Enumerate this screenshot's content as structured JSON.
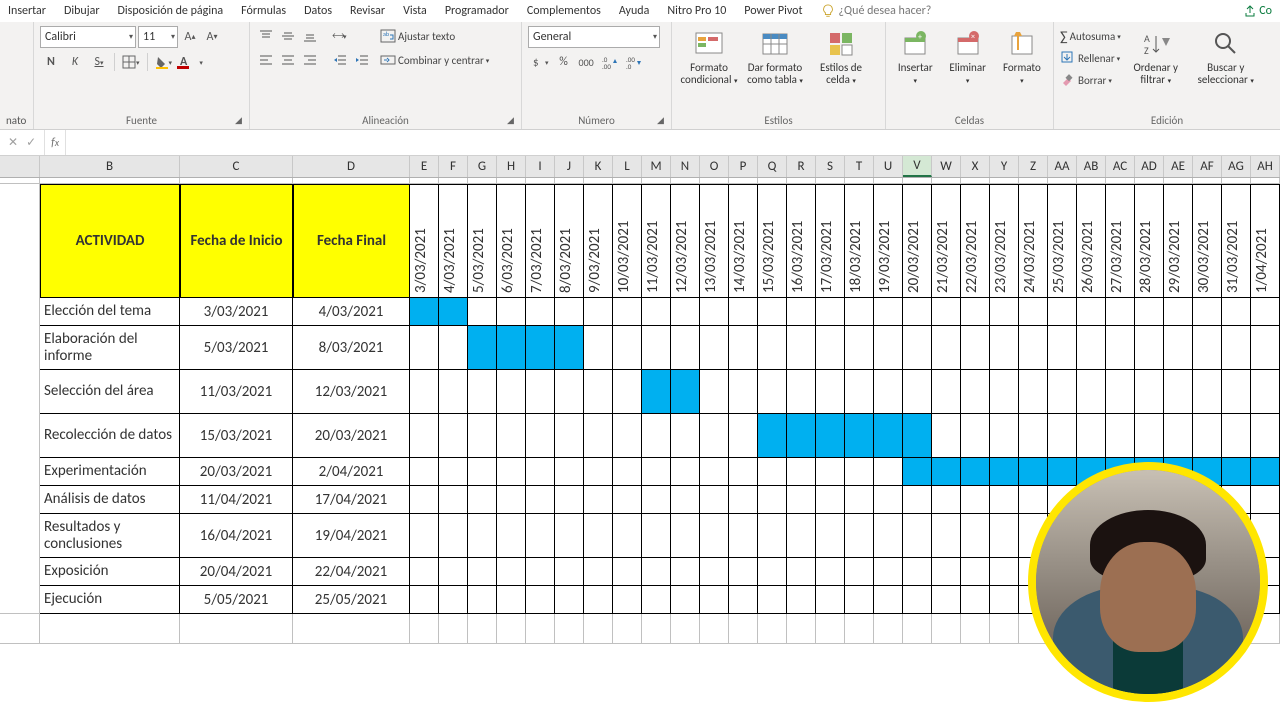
{
  "menu": {
    "tabs": [
      "Insertar",
      "Dibujar",
      "Disposición de página",
      "Fórmulas",
      "Datos",
      "Revisar",
      "Vista",
      "Programador",
      "Complementos",
      "Ayuda",
      "Nitro Pro 10",
      "Power Pivot"
    ],
    "tellme_placeholder": "¿Qué desea hacer?",
    "share": "Co"
  },
  "ribbon": {
    "clipboard_stub": "nato",
    "font": {
      "name": "Calibri",
      "size": "11",
      "bold": "N",
      "italic": "K",
      "underline": "S",
      "group_label": "Fuente"
    },
    "alignment": {
      "wrap": "Ajustar texto",
      "merge": "Combinar y centrar",
      "group_label": "Alineación"
    },
    "number": {
      "format": "General",
      "group_label": "Número"
    },
    "styles": {
      "cond": "Formato condicional",
      "table": "Dar formato como tabla",
      "cell": "Estilos de celda",
      "group_label": "Estilos"
    },
    "cells": {
      "insert": "Insertar",
      "delete": "Eliminar",
      "format": "Formato",
      "group_label": "Celdas"
    },
    "editing": {
      "sum": "Autosuma",
      "fill": "Rellenar",
      "clear": "Borrar",
      "sort": "Ordenar y filtrar",
      "find": "Buscar y seleccionar",
      "group_label": "Edición"
    }
  },
  "columns": [
    "",
    "B",
    "C",
    "D",
    "E",
    "F",
    "G",
    "H",
    "I",
    "J",
    "K",
    "L",
    "M",
    "N",
    "O",
    "P",
    "Q",
    "R",
    "S",
    "T",
    "U",
    "V",
    "W",
    "X",
    "Y",
    "Z",
    "AA",
    "AB",
    "AC",
    "AD",
    "AE",
    "AF",
    "AG",
    "AH"
  ],
  "selected_col": "V",
  "table": {
    "headers": {
      "b": "ACTIVIDAD",
      "c": "Fecha de Inicio",
      "d": "Fecha Final"
    },
    "dates": [
      "3/03/2021",
      "4/03/2021",
      "5/03/2021",
      "6/03/2021",
      "7/03/2021",
      "8/03/2021",
      "9/03/2021",
      "10/03/2021",
      "11/03/2021",
      "12/03/2021",
      "13/03/2021",
      "14/03/2021",
      "15/03/2021",
      "16/03/2021",
      "17/03/2021",
      "18/03/2021",
      "19/03/2021",
      "20/03/2021",
      "21/03/2021",
      "22/03/2021",
      "23/03/2021",
      "24/03/2021",
      "25/03/2021",
      "26/03/2021",
      "27/03/2021",
      "28/03/2021",
      "29/03/2021",
      "30/03/2021",
      "31/03/2021",
      "1/04/2021"
    ],
    "rows": [
      {
        "b": "Elección del tema",
        "c": "3/03/2021",
        "d": "4/03/2021",
        "start": 0,
        "end": 1,
        "h": "rowh1"
      },
      {
        "b": "Elaboración del informe",
        "c": "5/03/2021",
        "d": "8/03/2021",
        "start": 2,
        "end": 5,
        "h": "rowh2"
      },
      {
        "b": "Selección del área",
        "c": "11/03/2021",
        "d": "12/03/2021",
        "start": 8,
        "end": 9,
        "h": "rowh2"
      },
      {
        "b": "Recolección de datos",
        "c": "15/03/2021",
        "d": "20/03/2021",
        "start": 12,
        "end": 17,
        "h": "rowh2"
      },
      {
        "b": "Experimentación",
        "c": "20/03/2021",
        "d": "2/04/2021",
        "start": 17,
        "end": 29,
        "h": "rowh1"
      },
      {
        "b": "Análisis de datos",
        "c": "11/04/2021",
        "d": "17/04/2021",
        "start": -1,
        "end": -1,
        "h": "rowh1"
      },
      {
        "b": "Resultados y conclusiones",
        "c": "16/04/2021",
        "d": "19/04/2021",
        "start": -1,
        "end": -1,
        "h": "rowh2"
      },
      {
        "b": "Exposición",
        "c": "20/04/2021",
        "d": "22/04/2021",
        "start": -1,
        "end": -1,
        "h": "rowh1"
      },
      {
        "b": "Ejecución",
        "c": "5/05/2021",
        "d": "25/05/2021",
        "start": -1,
        "end": -1,
        "h": "rowh1"
      }
    ]
  }
}
